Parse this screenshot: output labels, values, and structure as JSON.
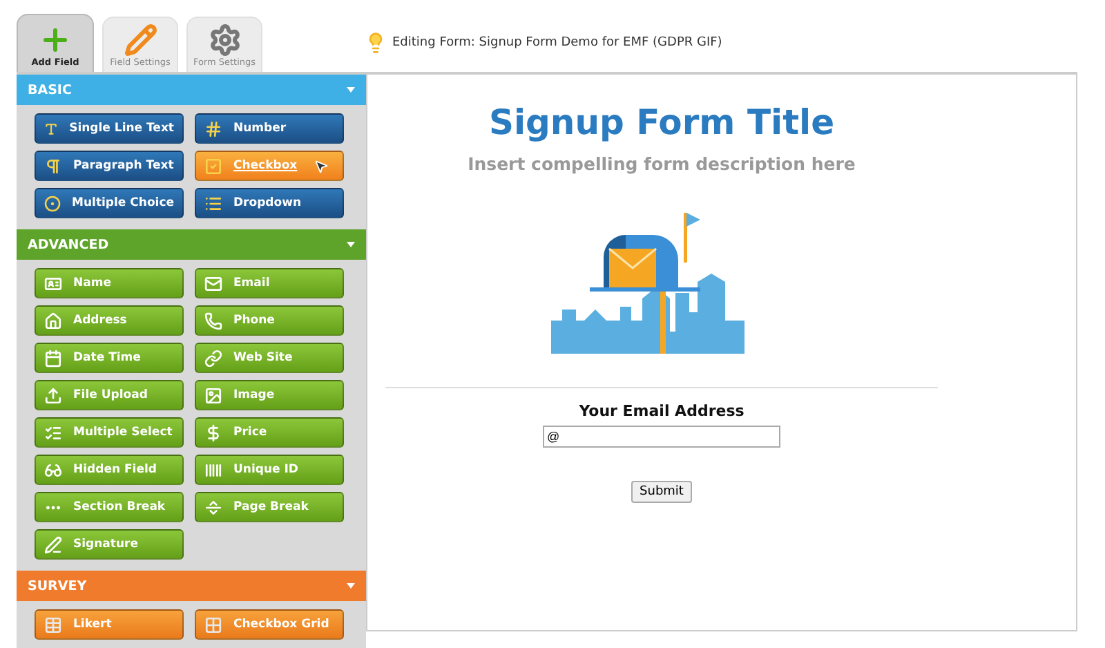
{
  "tabs": [
    {
      "label": "Add Field",
      "selected": true
    },
    {
      "label": "Field Settings",
      "selected": false
    },
    {
      "label": "Form Settings",
      "selected": false
    }
  ],
  "header": {
    "text": "Editing Form: Signup Form Demo for EMF (GDPR GIF)"
  },
  "sections": [
    {
      "title": "BASIC",
      "kind": "basic",
      "items": [
        {
          "label": "Single Line Text",
          "hovered": false
        },
        {
          "label": "Number",
          "hovered": false
        },
        {
          "label": "Paragraph Text",
          "hovered": false
        },
        {
          "label": "Checkbox",
          "hovered": true
        },
        {
          "label": "Multiple Choice",
          "hovered": false
        },
        {
          "label": "Dropdown",
          "hovered": false
        }
      ]
    },
    {
      "title": "ADVANCED",
      "kind": "advanced",
      "items": [
        {
          "label": "Name",
          "hovered": false
        },
        {
          "label": "Email",
          "hovered": false
        },
        {
          "label": "Address",
          "hovered": false
        },
        {
          "label": "Phone",
          "hovered": false
        },
        {
          "label": "Date Time",
          "hovered": false
        },
        {
          "label": "Web Site",
          "hovered": false
        },
        {
          "label": "File Upload",
          "hovered": false
        },
        {
          "label": "Image",
          "hovered": false
        },
        {
          "label": "Multiple Select",
          "hovered": false
        },
        {
          "label": "Price",
          "hovered": false
        },
        {
          "label": "Hidden Field",
          "hovered": false
        },
        {
          "label": "Unique ID",
          "hovered": false
        },
        {
          "label": "Section Break",
          "hovered": false
        },
        {
          "label": "Page Break",
          "hovered": false
        },
        {
          "label": "Signature",
          "hovered": false
        }
      ]
    },
    {
      "title": "SURVEY",
      "kind": "survey",
      "items": [
        {
          "label": "Likert",
          "hovered": false
        },
        {
          "label": "Checkbox Grid",
          "hovered": false
        }
      ]
    }
  ],
  "form": {
    "title": "Signup Form Title",
    "description": "Insert compelling form description here",
    "field_label": "Your Email Address",
    "field_value": "@",
    "submit": "Submit"
  }
}
